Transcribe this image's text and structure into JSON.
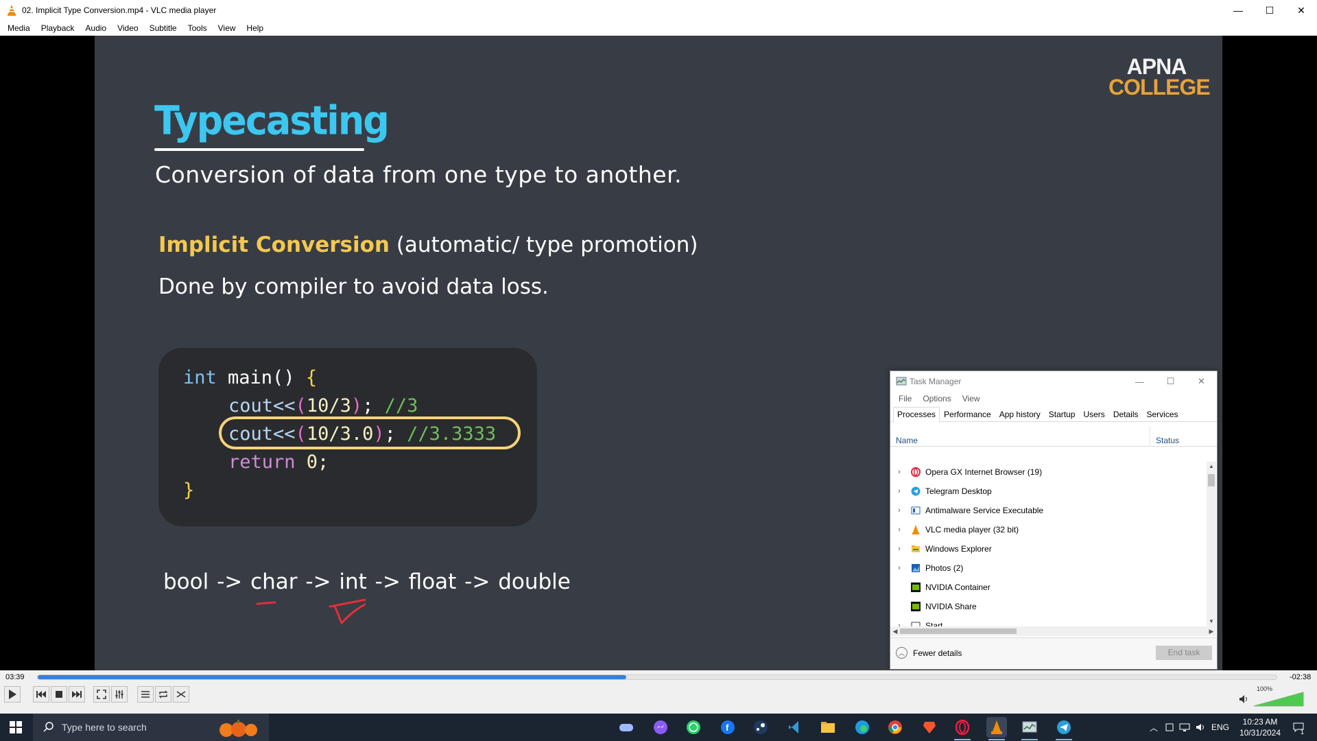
{
  "window": {
    "title": "02. Implicit Type Conversion.mp4 - VLC media player",
    "minimize": "—",
    "maximize": "☐",
    "close": "✕"
  },
  "menu": [
    "Media",
    "Playback",
    "Audio",
    "Video",
    "Subtitle",
    "Tools",
    "View",
    "Help"
  ],
  "slide": {
    "logo_line1": "APNA",
    "logo_line2": "COLLEGE",
    "title": "Typecasting",
    "subtitle": "Conversion of data from one type to another.",
    "impl_highlight": "Implicit Conversion",
    "impl_rest": " (automatic/ type promotion)",
    "done_line": "Done by compiler to avoid data loss.",
    "code": {
      "l1_int": "int",
      "l1_main": " main() ",
      "l1_brace": "{",
      "l2_cout": "cout<<",
      "l2_open": "(",
      "l2_expr": "10/3",
      "l2_close": ")",
      "l2_semi": "; ",
      "l2_comment": "//3",
      "l3_cout": "cout<<",
      "l3_open": "(",
      "l3_expr": "10/3.0",
      "l3_close": ")",
      "l3_semi": "; ",
      "l3_comment": "//3.3333",
      "l4_ret": "return",
      "l4_rest": " 0;",
      "l5_brace": "}"
    },
    "chain": "bool -> char -> int -> float -> double"
  },
  "task_manager": {
    "title": "Task Manager",
    "menu": [
      "File",
      "Options",
      "View"
    ],
    "tabs": [
      "Processes",
      "Performance",
      "App history",
      "Startup",
      "Users",
      "Details",
      "Services"
    ],
    "active_tab": "Processes",
    "col_name": "Name",
    "col_status": "Status",
    "processes": [
      {
        "name": "Opera GX Internet Browser (19)",
        "icon": "opera-icon",
        "expandable": true
      },
      {
        "name": "Telegram Desktop",
        "icon": "telegram-icon",
        "expandable": true
      },
      {
        "name": "Antimalware Service Executable",
        "icon": "defender-icon",
        "expandable": true
      },
      {
        "name": "VLC media player (32 bit)",
        "icon": "vlc-icon",
        "expandable": true
      },
      {
        "name": "Windows Explorer",
        "icon": "folder-icon",
        "expandable": true
      },
      {
        "name": "Photos (2)",
        "icon": "photos-icon",
        "expandable": true
      },
      {
        "name": "NVIDIA Container",
        "icon": "nvidia-icon",
        "expandable": false
      },
      {
        "name": "NVIDIA Share",
        "icon": "nvidia-icon",
        "expandable": false
      },
      {
        "name": "Start",
        "icon": "start-icon",
        "expandable": true
      }
    ],
    "fewer_details": "Fewer details",
    "end_task": "End task"
  },
  "player": {
    "elapsed": "03:39",
    "remaining": "-02:38",
    "progress_fraction": 0.475,
    "volume_label": "100%",
    "volume_fraction": 1.0
  },
  "taskbar": {
    "search_placeholder": "Type here to search",
    "pinned": [
      "game-controller-icon",
      "messenger-icon",
      "whatsapp-icon",
      "facebook-icon",
      "steam-icon",
      "vscode-icon",
      "file-explorer-icon",
      "edge-icon",
      "chrome-icon",
      "brave-icon",
      "opera-gx-icon",
      "vlc-icon",
      "task-manager-icon",
      "telegram-icon"
    ],
    "language": "ENG",
    "time": "10:23 AM",
    "date": "10/31/2024",
    "notification_count": "1"
  },
  "colors": {
    "slide_bg": "#383d45",
    "title_blue": "#3cc7f0",
    "highlight_yellow": "#f4c84f",
    "seek_blue": "#3a7fd6",
    "taskbar_bg": "#1b2431"
  }
}
